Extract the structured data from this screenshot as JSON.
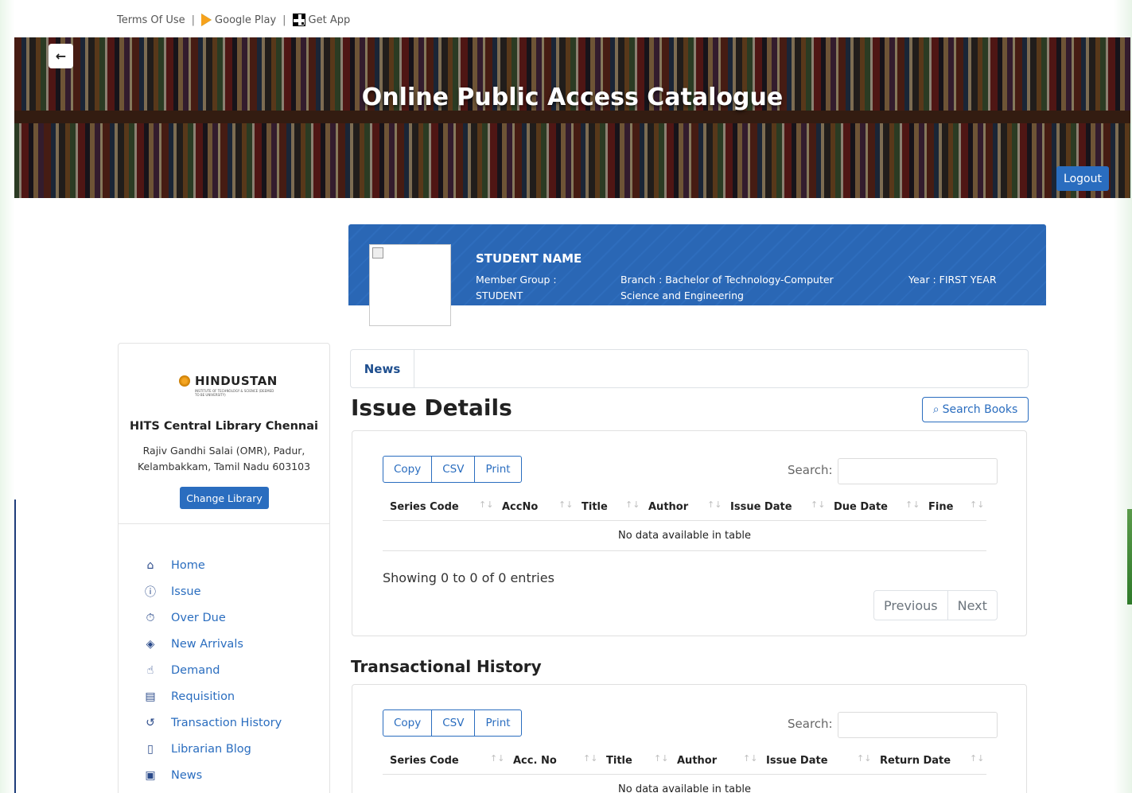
{
  "top_links": {
    "terms": "Terms Of Use",
    "separator": "|",
    "google_play": "Google Play",
    "get_app": "Get App"
  },
  "banner": {
    "title": "Online Public Access Catalogue",
    "back_icon": "arrow-left-icon",
    "logout_label": "Logout"
  },
  "student": {
    "name": "STUDENT NAME",
    "member_group": "Member Group : STUDENT",
    "branch": "Branch : Bachelor of Technology-Computer Science and Engineering",
    "year": "Year : FIRST YEAR"
  },
  "library": {
    "logo_text": "HINDUSTAN",
    "logo_sub": "INSTITUTE OF TECHNOLOGY & SCIENCE (DEEMED TO BE UNIVERSITY)",
    "name": "HITS Central Library Chennai",
    "address": "Rajiv Gandhi Salai (OMR), Padur, Kelambakkam, Tamil Nadu 603103",
    "change_label": "Change Library"
  },
  "sidebar": {
    "items": [
      {
        "label": "Home",
        "icon": "home-icon",
        "glyph": "⌂"
      },
      {
        "label": "Issue",
        "icon": "alert-circle-icon",
        "glyph": "ⓘ"
      },
      {
        "label": "Over Due",
        "icon": "clock-money-icon",
        "glyph": "⏱"
      },
      {
        "label": "New Arrivals",
        "icon": "diamond-icon",
        "glyph": "◈"
      },
      {
        "label": "Demand",
        "icon": "cursor-click-icon",
        "glyph": "☝"
      },
      {
        "label": "Requisition",
        "icon": "form-icon",
        "glyph": "▤"
      },
      {
        "label": "Transaction History",
        "icon": "history-icon",
        "glyph": "↺"
      },
      {
        "label": "Librarian Blog",
        "icon": "book-icon",
        "glyph": "▯"
      },
      {
        "label": "News",
        "icon": "document-icon",
        "glyph": "▣"
      }
    ]
  },
  "tabs": {
    "news": "News"
  },
  "issue_details": {
    "title": "Issue Details",
    "search_books_label": "Search Books",
    "buttons": [
      "Copy",
      "CSV",
      "Print"
    ],
    "search_label": "Search:",
    "columns": [
      "Series Code",
      "AccNo",
      "Title",
      "Author",
      "Issue Date",
      "Due Date",
      "Fine"
    ],
    "empty_text": "No data available in table",
    "showing": "Showing 0 to 0 of 0 entries",
    "prev_label": "Previous",
    "next_label": "Next"
  },
  "transactional_history": {
    "title": "Transactional History",
    "buttons": [
      "Copy",
      "CSV",
      "Print"
    ],
    "search_label": "Search:",
    "columns": [
      "Series Code",
      "Acc. No",
      "Title",
      "Author",
      "Issue Date",
      "Return Date"
    ],
    "empty_text": "No data available in table"
  },
  "colors": {
    "primary": "#2a6dbf",
    "card_blue": "#2a67b5",
    "text": "#212529"
  }
}
